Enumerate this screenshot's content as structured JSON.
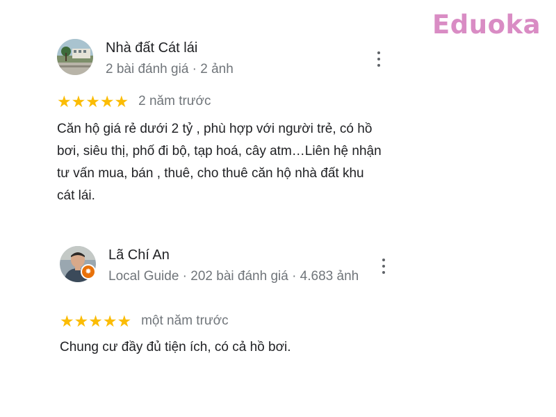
{
  "watermark": {
    "text": "Eduoka",
    "color": "#d98cc4"
  },
  "reviews": [
    {
      "reviewer_name": "Nhà đất Cát lái",
      "meta": "2 bài đánh giá · 2 ảnh",
      "stars": 5,
      "stars_text": "★★★★★",
      "time": "2 năm trước",
      "text": "Căn hộ giá rẻ dưới 2 tỷ , phù hợp với người trẻ, có hồ bơi, siêu thị, phố đi bộ, tạp hoá, cây atm…Liên hệ nhận tư vấn mua, bán , thuê, cho thuê căn hộ nhà đất khu cát lái.",
      "avatar_icon": "landscape-photo-avatar",
      "local_guide": false
    },
    {
      "reviewer_name": "Lã Chí An",
      "meta": "Local Guide · 202 bài đánh giá · 4.683 ảnh",
      "stars": 5,
      "stars_text": "★★★★★",
      "time": "một năm trước",
      "text": "Chung cư đầy đủ tiện ích, có cả hồ bơi.",
      "avatar_icon": "person-photo-avatar",
      "local_guide": true,
      "badge_icon": "local-guide-badge-icon"
    }
  ],
  "colors": {
    "star": "#fbbc04",
    "secondary_text": "#70757a",
    "primary_text": "#202124",
    "local_guide_badge": "#e8710a"
  },
  "icons": {
    "more": "more-vert-icon"
  }
}
